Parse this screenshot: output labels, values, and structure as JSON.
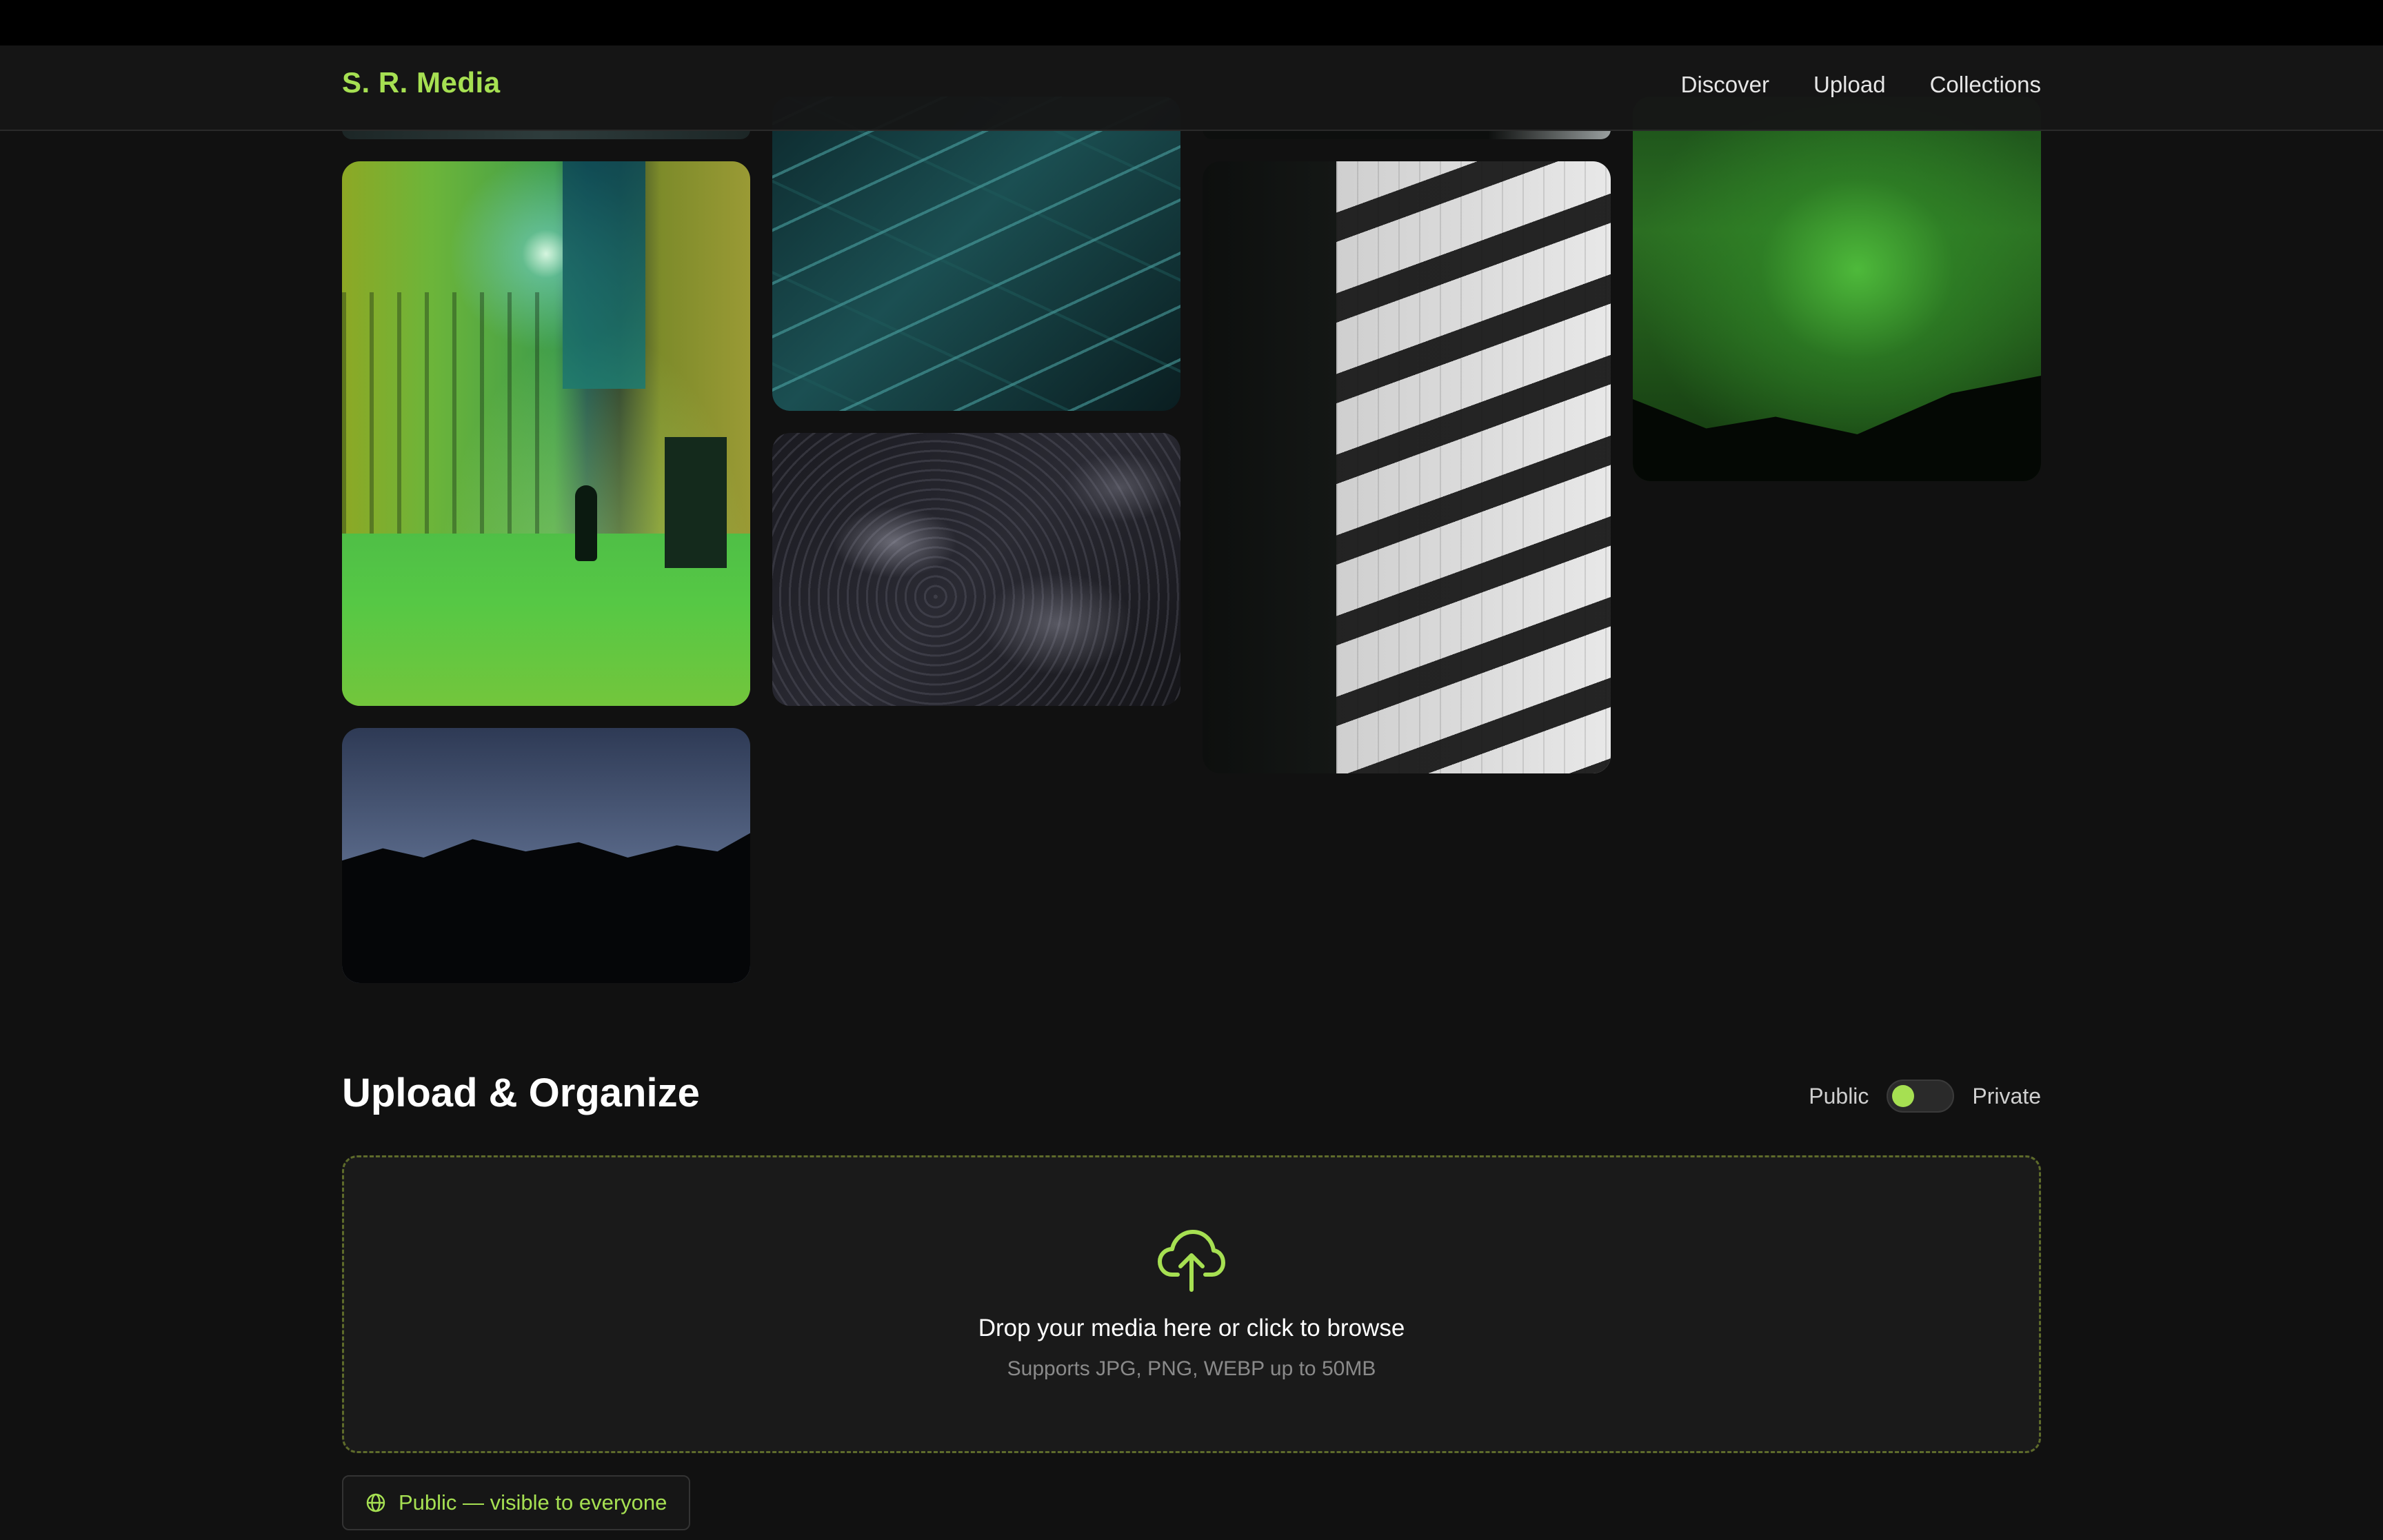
{
  "brand": {
    "logo": "S. R. Media",
    "accent": "#a6e052"
  },
  "nav": {
    "links": [
      "Discover",
      "Upload",
      "Collections"
    ]
  },
  "gallery": {
    "images": [
      {
        "id": "street",
        "icon": "photo-green-alley"
      },
      {
        "id": "leaves",
        "icon": "photo-teal-leaves"
      },
      {
        "id": "ocean",
        "icon": "photo-ocean-texture"
      },
      {
        "id": "wall",
        "icon": "photo-shadow-wall"
      },
      {
        "id": "aurora",
        "icon": "photo-aurora"
      },
      {
        "id": "mountain",
        "icon": "photo-mountain-silhouette"
      }
    ]
  },
  "upload": {
    "title": "Upload & Organize",
    "visibility": {
      "left_label": "Public",
      "right_label": "Private",
      "value": "Public"
    },
    "dropzone": {
      "icon": "cloud-upload-icon",
      "title": "Drop your media here or click to browse",
      "subtitle": "Supports JPG, PNG, WEBP up to 50MB"
    },
    "status_pill": {
      "icon": "globe-icon",
      "text": "Public — visible to everyone"
    }
  }
}
